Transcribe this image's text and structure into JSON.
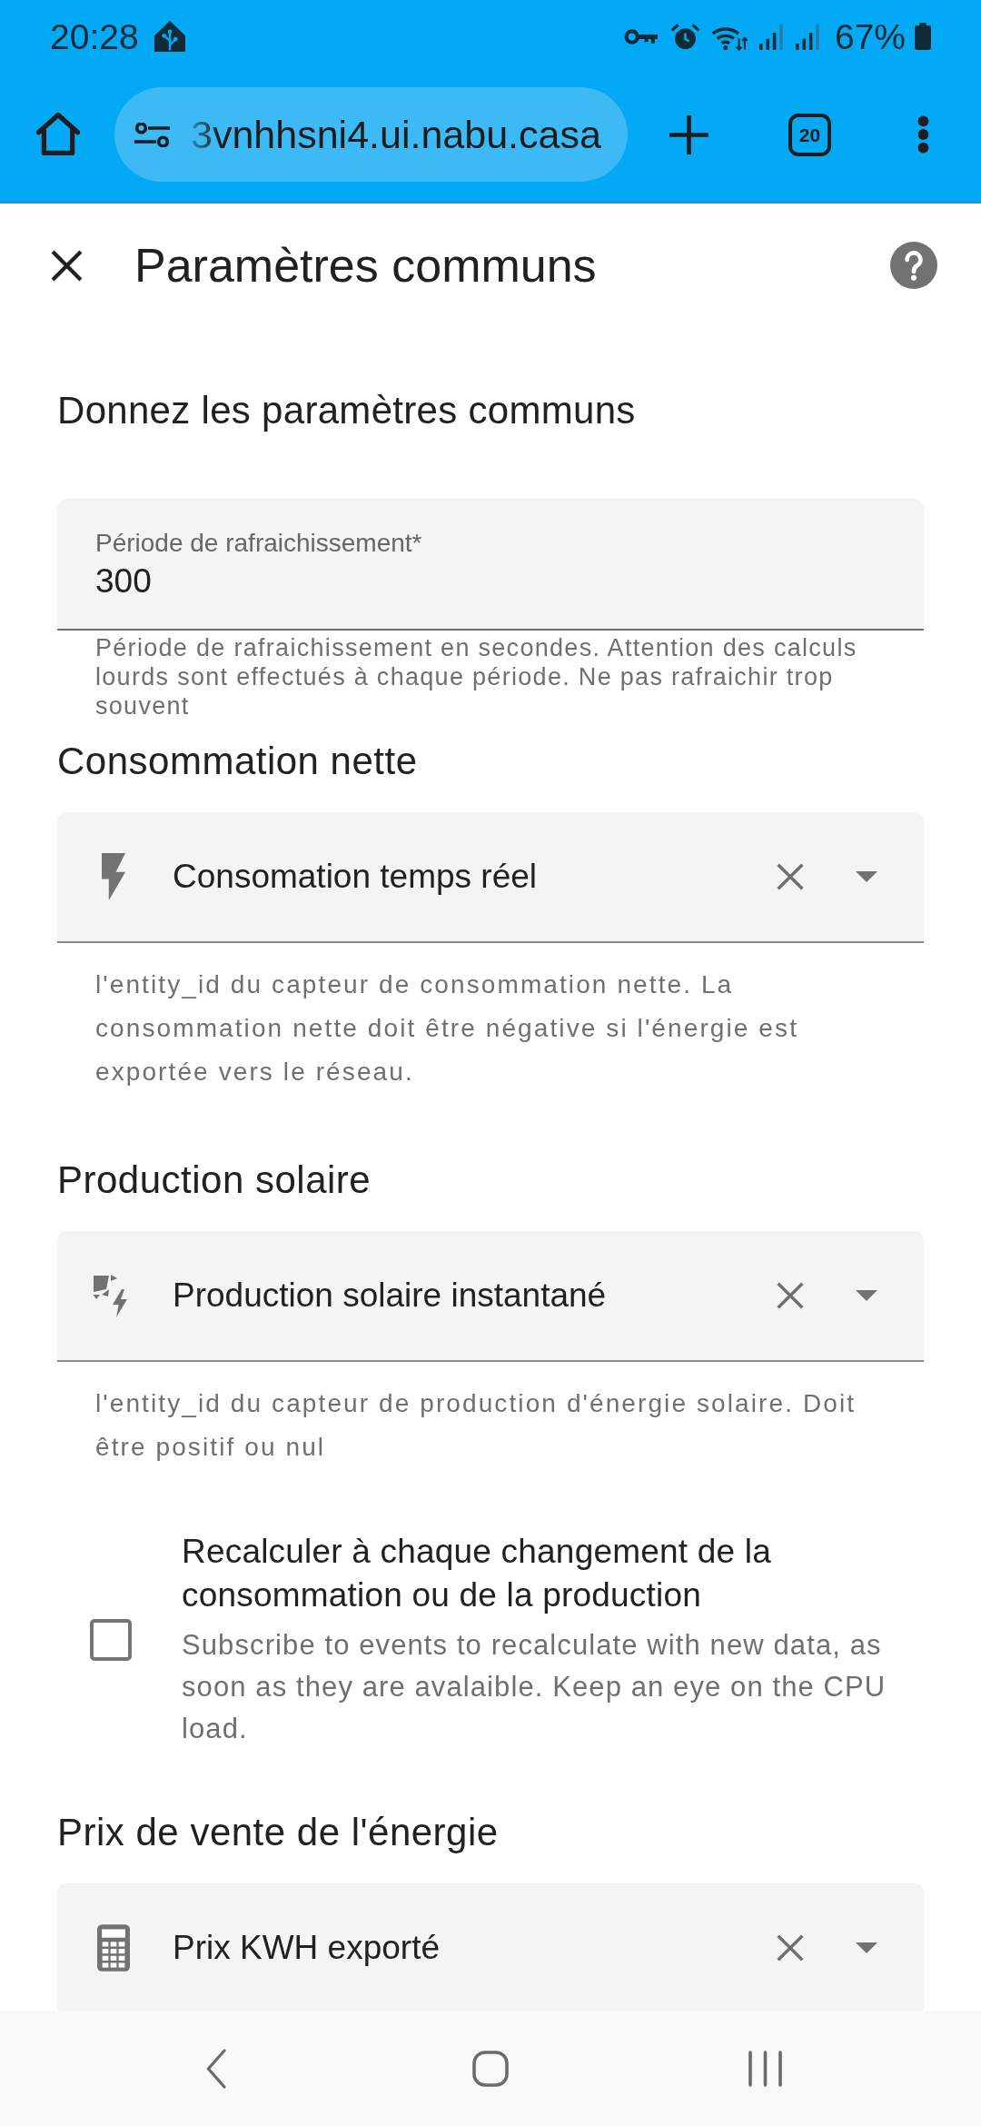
{
  "status_bar": {
    "time": "20:28",
    "battery": "67%"
  },
  "browser": {
    "url": "3vnhhsni4.ui.nabu.casa",
    "tab_count": "20"
  },
  "dialog": {
    "title": "Paramètres communs"
  },
  "form": {
    "heading": "Donnez les paramètres communs",
    "items": [
      {
        "kind": "textfield",
        "label": "Période de rafraichissement*",
        "value": "300",
        "helper": "Période de rafraichissement en secondes. Attention des calculs lourds sont effectués à chaque période. Ne pas rafraichir trop souvent"
      },
      {
        "kind": "entity",
        "heading": "Consommation nette",
        "value": "Consomation temps réel",
        "helper": "l'entity_id du capteur de consommation nette. La consommation nette doit être négative si l'énergie est exportée vers le réseau."
      },
      {
        "kind": "entity",
        "heading": "Production solaire",
        "value": "Production solaire instantané",
        "helper": "l'entity_id du capteur de production d'énergie solaire. Doit être positif ou nul"
      },
      {
        "kind": "checkbox",
        "label": "Recalculer à chaque changement de la consommation ou de la production",
        "description": "Subscribe to events to recalculate with new data, as soon as they are avalaible. Keep an eye on the CPU load.",
        "checked": false
      },
      {
        "kind": "entity",
        "heading": "Prix de vente de l'énergie",
        "value": "Prix KWH exporté"
      }
    ]
  }
}
